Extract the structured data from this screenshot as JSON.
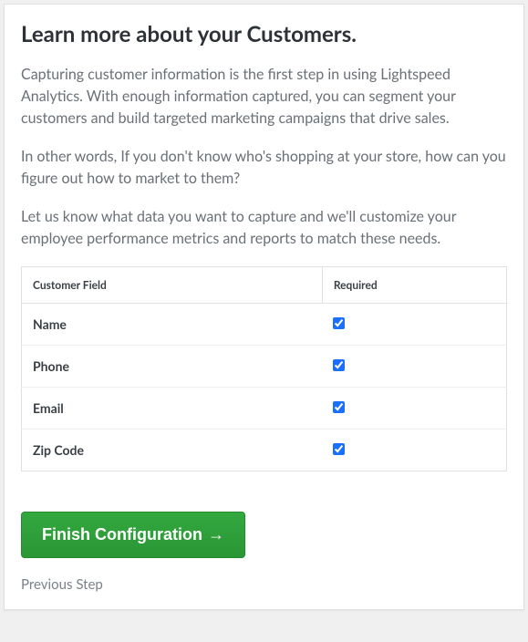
{
  "header": {
    "title": "Learn more about your Customers."
  },
  "paragraphs": [
    "Capturing customer information is the first step in using Lightspeed Analytics. With enough information captured, you can segment your customers and build targeted marketing campaigns that drive sales.",
    "In other words, If you don't know who's shopping at your store, how can you figure out how to market to them?",
    "Let us know what data you want to capture and we'll customize your employee performance metrics and reports to match these needs."
  ],
  "table": {
    "headers": {
      "field": "Customer Field",
      "required": "Required"
    },
    "rows": [
      {
        "label": "Name",
        "required": true
      },
      {
        "label": "Phone",
        "required": true
      },
      {
        "label": "Email",
        "required": true
      },
      {
        "label": "Zip Code",
        "required": true
      }
    ]
  },
  "actions": {
    "finish_label": "Finish Configuration",
    "arrow_glyph": "→",
    "previous_label": "Previous Step"
  }
}
